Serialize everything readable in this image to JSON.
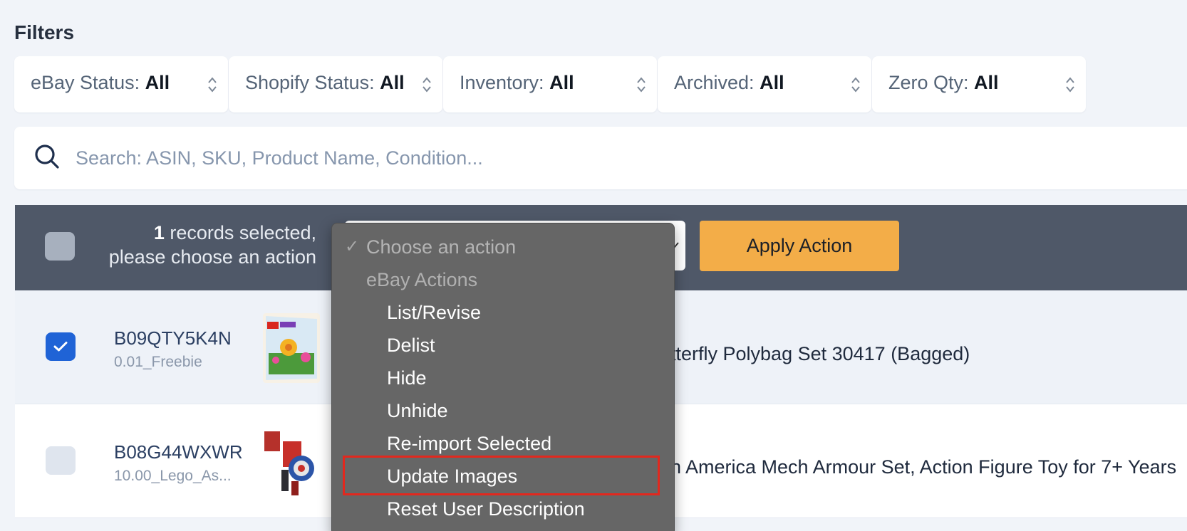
{
  "filters": {
    "title": "Filters",
    "items": [
      {
        "label": "eBay Status:",
        "value": "All"
      },
      {
        "label": "Shopify Status:",
        "value": "All"
      },
      {
        "label": "Inventory:",
        "value": "All"
      },
      {
        "label": "Archived:",
        "value": "All"
      },
      {
        "label": "Zero Qty:",
        "value": "All"
      }
    ]
  },
  "search": {
    "placeholder": "Search: ASIN, SKU, Product Name, Condition...",
    "value": ""
  },
  "action_bar": {
    "selected_count": "1",
    "selected_text": " records selected,",
    "prompt_text": "please choose an action",
    "apply_label": "Apply Action"
  },
  "dropdown": {
    "placeholder": "Choose an action",
    "check_glyph": "✓",
    "group_label": "eBay Actions",
    "options": [
      "List/Revise",
      "Delist",
      "Hide",
      "Unhide",
      "Re-import Selected",
      "Update Images",
      "Reset User Description"
    ],
    "highlighted": "Update Images"
  },
  "products": [
    {
      "asin": "B09QTY5K4N",
      "sku": "0.01_Freebie",
      "title_visible": "tterfly Polybag Set 30417 (Bagged)",
      "selected": true
    },
    {
      "asin": "B08G44WXWR",
      "sku": "10.00_Lego_As...",
      "title_visible": "n America Mech Armour Set, Action Figure Toy for 7+ Years",
      "selected": false
    }
  ],
  "colors": {
    "action_bar_bg": "#4f5868",
    "apply_button_bg": "#f3ad48",
    "checkbox_checked": "#1f63d6",
    "dropdown_bg": "#666666",
    "highlight_border": "#e2281e"
  }
}
